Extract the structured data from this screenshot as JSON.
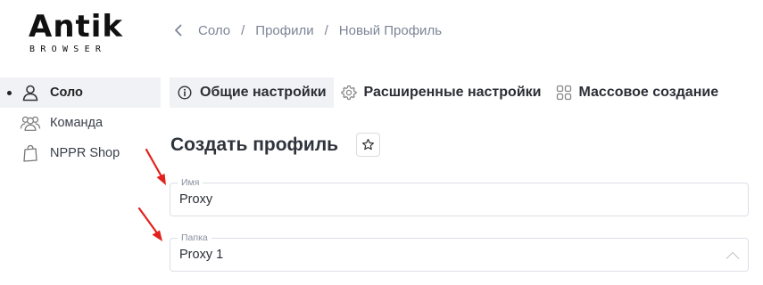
{
  "logo": {
    "word": "Antik",
    "subtitle": "BROWSER"
  },
  "breadcrumb": {
    "items": [
      "Соло",
      "Профили",
      "Новый Профиль"
    ],
    "separator": "/"
  },
  "sidebar": {
    "items": [
      {
        "label": "Соло",
        "icon": "user-icon",
        "active": true
      },
      {
        "label": "Команда",
        "icon": "team-icon",
        "active": false
      },
      {
        "label": "NPPR Shop",
        "icon": "shopping-bag-icon",
        "active": false
      }
    ]
  },
  "tabs": [
    {
      "label": "Общие настройки",
      "icon": "info-icon",
      "active": true
    },
    {
      "label": "Расширенные настройки",
      "icon": "gear-icon",
      "active": false
    },
    {
      "label": "Массовое создание",
      "icon": "grid-icon",
      "active": false
    }
  ],
  "page": {
    "title": "Создать профиль"
  },
  "form": {
    "name": {
      "label": "Имя",
      "value": "Proxy"
    },
    "folder": {
      "label": "Папка",
      "value": "Proxy 1"
    }
  },
  "colors": {
    "annotation_arrow": "#e3211c",
    "active_bg": "#f1f2f5",
    "muted_text": "#7c8496"
  }
}
